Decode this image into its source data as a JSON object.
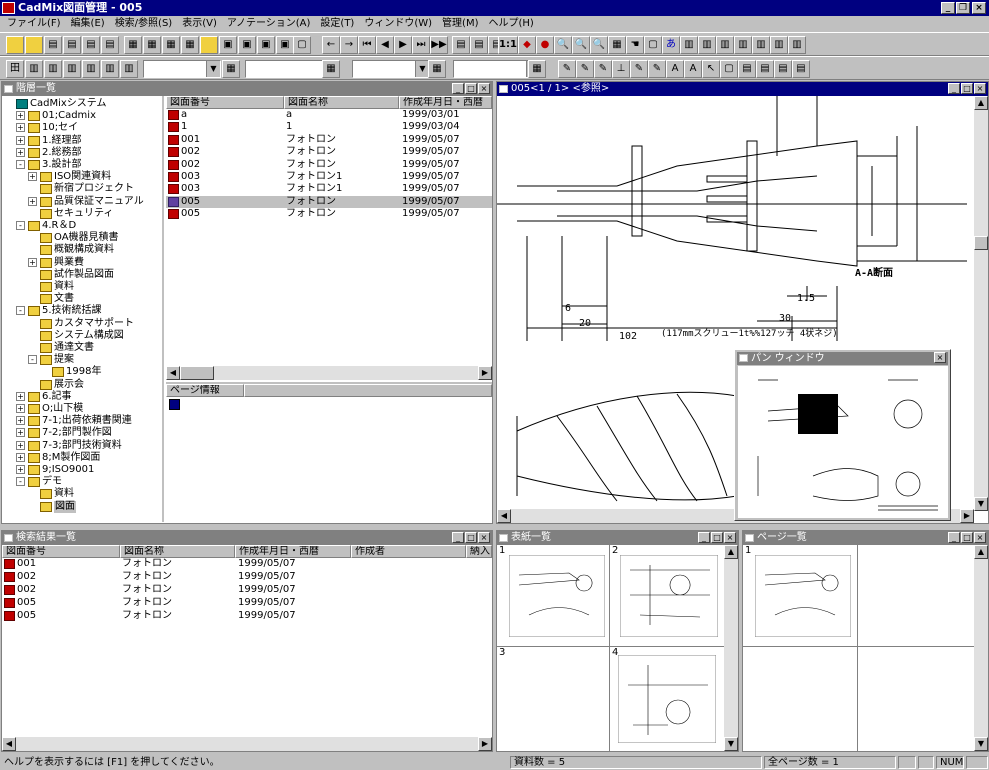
{
  "window": {
    "title": "CadMix図面管理 - 005"
  },
  "menu": [
    "ファイル(F)",
    "編集(E)",
    "検索/参照(S)",
    "表示(V)",
    "アノテーション(A)",
    "設定(T)",
    "ウィンドウ(W)",
    "管理(M)",
    "ヘルプ(H)"
  ],
  "tree_panel": {
    "title": "階層一覧",
    "items": [
      {
        "label": "CadMixシステム",
        "level": 0,
        "expander": ""
      },
      {
        "label": "01;Cadmix",
        "level": 1,
        "expander": "+"
      },
      {
        "label": "10;セイ",
        "level": 1,
        "expander": "+"
      },
      {
        "label": "1.経理部",
        "level": 1,
        "expander": "+"
      },
      {
        "label": "2.総務部",
        "level": 1,
        "expander": "+"
      },
      {
        "label": "3.設計部",
        "level": 1,
        "expander": "-"
      },
      {
        "label": "ISO関連資料",
        "level": 2,
        "expander": "+"
      },
      {
        "label": "新宿プロジェクト",
        "level": 2,
        "expander": ""
      },
      {
        "label": "品質保証マニュアル",
        "level": 2,
        "expander": "+"
      },
      {
        "label": "セキュリティ",
        "level": 2,
        "expander": ""
      },
      {
        "label": "4.R＆D",
        "level": 1,
        "expander": "-"
      },
      {
        "label": "OA機器見積書",
        "level": 2,
        "expander": ""
      },
      {
        "label": "概観構成資料",
        "level": 2,
        "expander": ""
      },
      {
        "label": "興業費",
        "level": 2,
        "expander": "+"
      },
      {
        "label": "試作製品図面",
        "level": 2,
        "expander": ""
      },
      {
        "label": "資料",
        "level": 2,
        "expander": ""
      },
      {
        "label": "文書",
        "level": 2,
        "expander": ""
      },
      {
        "label": "5.技術統括課",
        "level": 1,
        "expander": "-"
      },
      {
        "label": "カスタマサポート",
        "level": 2,
        "expander": ""
      },
      {
        "label": "システム構成図",
        "level": 2,
        "expander": ""
      },
      {
        "label": "通達文書",
        "level": 2,
        "expander": ""
      },
      {
        "label": "提案",
        "level": 2,
        "expander": "-"
      },
      {
        "label": "1998年",
        "level": 3,
        "expander": ""
      },
      {
        "label": "展示会",
        "level": 2,
        "expander": ""
      },
      {
        "label": "6.記事",
        "level": 1,
        "expander": "+"
      },
      {
        "label": "O;山下模",
        "level": 1,
        "expander": "+"
      },
      {
        "label": "7-1;出荷依頼書関連",
        "level": 1,
        "expander": "+"
      },
      {
        "label": "7-2;部門製作図",
        "level": 1,
        "expander": "+"
      },
      {
        "label": "7-3;部門技術資料",
        "level": 1,
        "expander": "+"
      },
      {
        "label": "8;M製作図面",
        "level": 1,
        "expander": "+"
      },
      {
        "label": "9;ISO9001",
        "level": 1,
        "expander": "+"
      },
      {
        "label": "デモ",
        "level": 1,
        "expander": "-"
      },
      {
        "label": "資料",
        "level": 2,
        "expander": ""
      },
      {
        "label": "図面",
        "level": 2,
        "expander": ""
      }
    ]
  },
  "drawing_list": {
    "headers": [
      "図面番号",
      "図面名称",
      "作成年月日・西暦"
    ],
    "rows": [
      {
        "no": "a",
        "name": "a",
        "date": "1999/03/01"
      },
      {
        "no": "1",
        "name": "1",
        "date": "1999/03/04"
      },
      {
        "no": "001",
        "name": "フォトロン",
        "date": "1999/05/07"
      },
      {
        "no": "002",
        "name": "フォトロン",
        "date": "1999/05/07"
      },
      {
        "no": "002",
        "name": "フォトロン",
        "date": "1999/05/07"
      },
      {
        "no": "003",
        "name": "フォトロン1",
        "date": "1999/05/07"
      },
      {
        "no": "003",
        "name": "フォトロン1",
        "date": "1999/05/07"
      },
      {
        "no": "005",
        "name": "フォトロン",
        "date": "1999/05/07"
      },
      {
        "no": "005",
        "name": "フォトロン",
        "date": "1999/05/07"
      }
    ]
  },
  "page_info": {
    "title": "ページ情報"
  },
  "viewer": {
    "title": "005<1 / 1> <参照>",
    "dims": {
      "d6": "6",
      "d20": "20",
      "d102": "102",
      "d30": "30",
      "d15": "1.5",
      "note": "(117mmスクリュー1t%%127ッチ 4状ネジ)",
      "section": "A-A断面"
    }
  },
  "pan_window": {
    "title": "パン ウィンドウ"
  },
  "search_results": {
    "title": "検索結果一覧",
    "headers": [
      "図面番号",
      "図面名称",
      "作成年月日・西暦",
      "作成者",
      "納入"
    ],
    "rows": [
      {
        "no": "001",
        "name": "フォトロン",
        "date": "1999/05/07"
      },
      {
        "no": "002",
        "name": "フォトロン",
        "date": "1999/05/07"
      },
      {
        "no": "002",
        "name": "フォトロン",
        "date": "1999/05/07"
      },
      {
        "no": "005",
        "name": "フォトロン",
        "date": "1999/05/07"
      },
      {
        "no": "005",
        "name": "フォトロン",
        "date": "1999/05/07"
      }
    ]
  },
  "sheet_list": {
    "title": "表紙一覧",
    "cells": [
      "1",
      "2",
      "3",
      "4"
    ]
  },
  "page_list": {
    "title": "ページ一覧",
    "cells": [
      "1"
    ]
  },
  "status": {
    "help": "ヘルプを表示するには [F1] を押してください。",
    "count": "資料数 = 5",
    "pages": "全ページ数 = 1",
    "num": "NUM"
  },
  "colors": {
    "titlebar": "#000080",
    "face": "#c0c0c0",
    "selection": "#c0c0c0"
  }
}
